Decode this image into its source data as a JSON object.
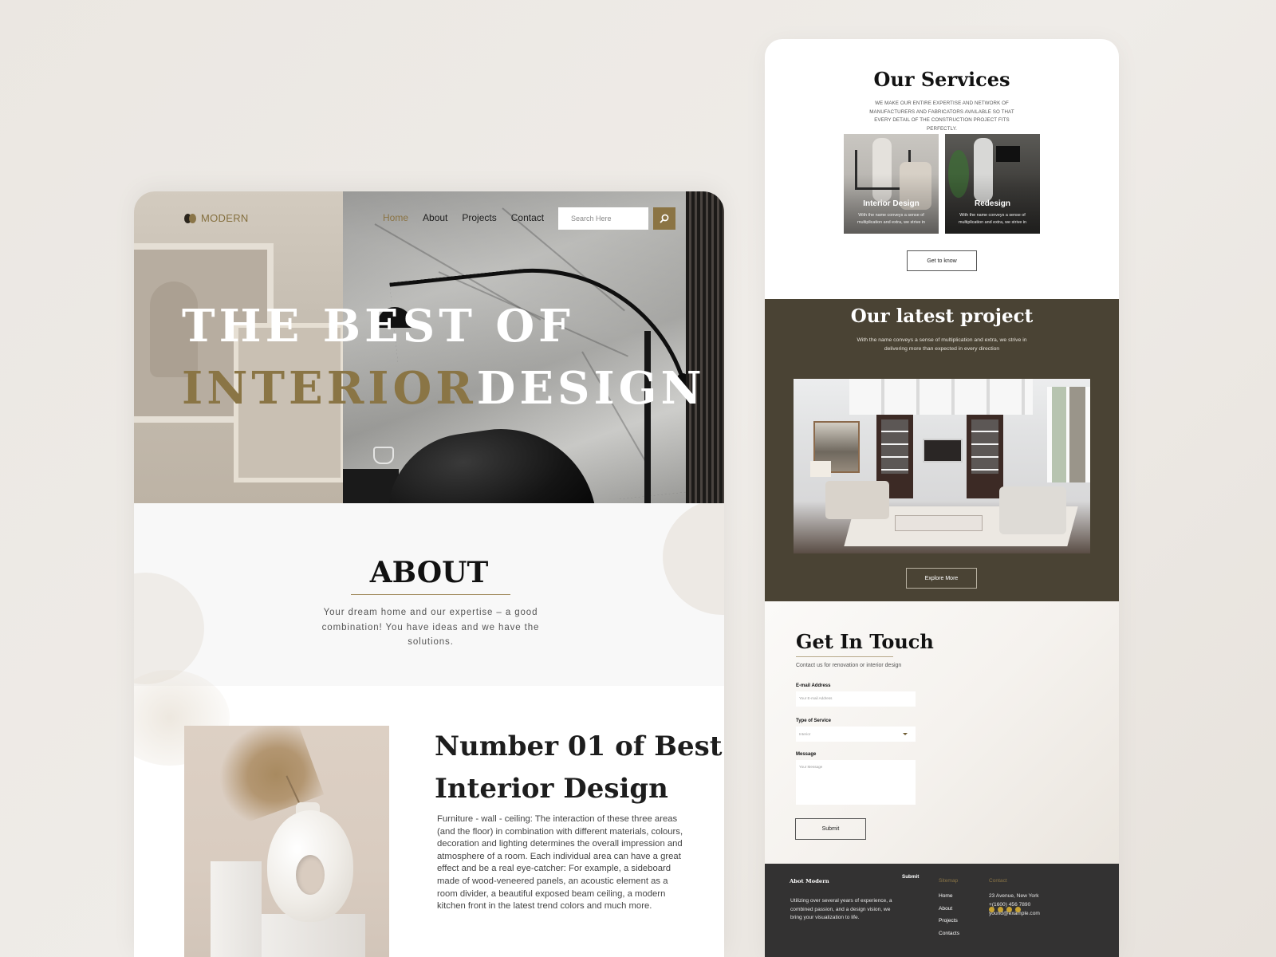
{
  "left_page": {
    "nav": {
      "logo_text": "MODERN",
      "links": [
        "Home",
        "About",
        "Projects",
        "Contact"
      ],
      "active_link": "Home",
      "search_placeholder": "Search Here",
      "search_icon": "search-icon"
    },
    "hero": {
      "line1": "THE BEST OF",
      "line2_gold": "INTERIOR",
      "line2_white": "DESIGN"
    },
    "about": {
      "title": "ABOUT",
      "text": "Your dream home and our expertise – a good combination! You have ideas and we have the solutions."
    },
    "feature": {
      "title_line1": "Number 01 of Best",
      "title_line2": "Interior Design",
      "text": "Furniture - wall - ceiling: The interaction of these three areas (and the floor) in combination with different materials, colours, decoration and lighting determines the overall impression and atmosphere of a room. Each individual area can have a great effect and be a real eye-catcher: For example, a sideboard made of wood-veneered panels, an acoustic element as a room divider, a beautiful exposed beam ceiling, a modern kitchen front in the latest trend colors and much more."
    }
  },
  "right_page": {
    "services": {
      "title": "Our Services",
      "subtitle": "WE MAKE OUR ENTIRE EXPERTISE AND NETWORK OF MANUFACTURERS AND FABRICATORS AVAILABLE SO THAT EVERY DETAIL OF THE CONSTRUCTION PROJECT FITS PERFECTLY.",
      "cards": [
        {
          "title": "Interior Design",
          "text": "With the name conveys a sense of multiplication and extra, we strive in"
        },
        {
          "title": "Redesign",
          "text": "With the name conveys a sense of multiplication and extra, we strive in"
        }
      ],
      "button": "Get to know"
    },
    "project": {
      "title": "Our latest project",
      "subtitle": "With the name conveys a sense of multiplication and extra, we strive in delivering more than expected in every direction",
      "button": "Explore More"
    },
    "contact": {
      "title": "Get In Touch",
      "subtitle": "Contact us for renovation or interior design",
      "email_label": "E-mail Address",
      "email_placeholder": "Your E-mail Address",
      "service_label": "Type of Service",
      "service_value": "Interior",
      "message_label": "Message",
      "message_placeholder": "Your Message",
      "submit": "Submit"
    },
    "footer": {
      "about_title": "Abot Modern",
      "about_text": "Utilizing over several years of experience, a combined passion, and a design vision, we bring your visualization to life.",
      "submit_label": "Submit",
      "sitemap_title": "Sitemap",
      "sitemap_links": [
        "Home",
        "About",
        "Projects",
        "Contacts"
      ],
      "contact_title": "Contact",
      "contact_lines": [
        "23 Avenue, New York",
        "+(1600) 456 7890",
        "yourid@example.com"
      ]
    }
  },
  "colors": {
    "accent_gold": "#8b7444",
    "project_bg": "#4a4334",
    "footer_bg": "#333232"
  }
}
